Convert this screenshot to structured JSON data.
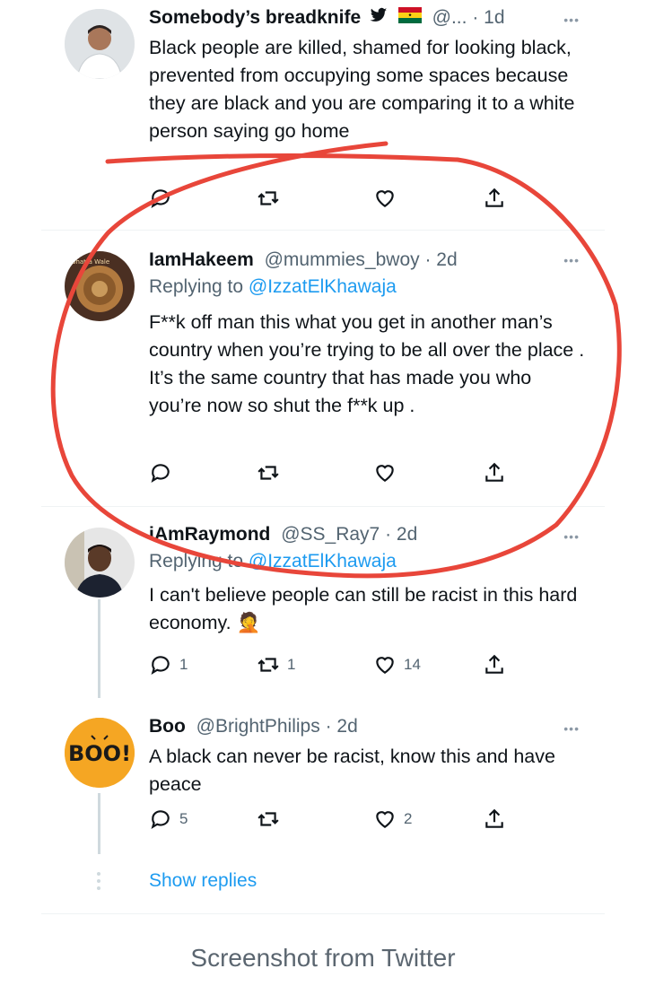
{
  "tweets": [
    {
      "name": "Somebody’s breadknife",
      "badges": "🌍",
      "handle": "@...",
      "time": "· 1d",
      "reply_to_prefix": "",
      "reply_to": "",
      "text": "Black people are killed, shamed for looking black, prevented from occupying some spaces because they are black and you are comparing it to a white person saying go home",
      "replies": "",
      "retweets": "",
      "likes": ""
    },
    {
      "name": "IamHakeem",
      "handle": "@mummies_bwoy",
      "time": "· 2d",
      "reply_to_prefix": "Replying to ",
      "reply_to": "@IzzatElKhawaja",
      "text": "F**k off man this what you get in another man’s country when you’re trying to be all over the place . It’s the same country that has made you who you’re now so shut the f**k up .",
      "replies": "",
      "retweets": "",
      "likes": ""
    },
    {
      "name": "iAmRaymond",
      "handle": "@SS_Ray7",
      "time": "· 2d",
      "reply_to_prefix": "Replying to ",
      "reply_to": "@IzzatElKhawaja",
      "text": "I can't believe people can still be racist in this hard economy.",
      "emoji": "🤦",
      "replies": "1",
      "retweets": "1",
      "likes": "14"
    },
    {
      "name": "Boo",
      "handle": "@BrightPhilips",
      "time": "· 2d",
      "reply_to_prefix": "",
      "reply_to": "",
      "text": "A black can never be racist, know this and have peace",
      "replies": "5",
      "retweets": "",
      "likes": "2"
    }
  ],
  "more_label": "•••",
  "show_replies": "Show replies",
  "boo_avatar_text": "BOO!",
  "caption": "Screenshot from Twitter",
  "colors": {
    "link": "#1d9bf0",
    "annotation": "#e8463a"
  }
}
